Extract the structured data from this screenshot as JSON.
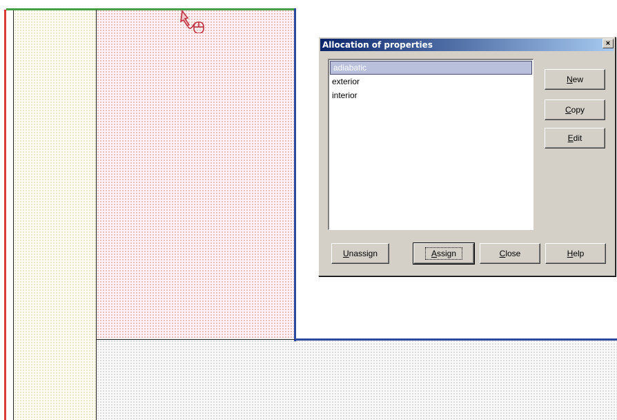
{
  "dialog": {
    "title": "Allocation of properties",
    "close_glyph": "×",
    "list_items": [
      {
        "label": "adiabatic",
        "selected": true
      },
      {
        "label": "exterior",
        "selected": false
      },
      {
        "label": "interior",
        "selected": false
      }
    ],
    "buttons": {
      "new": {
        "pre": "",
        "mn": "N",
        "post": "ew"
      },
      "copy": {
        "pre": "",
        "mn": "C",
        "post": "opy"
      },
      "edit": {
        "pre": "",
        "mn": "E",
        "post": "dit"
      },
      "unassign": {
        "pre": "",
        "mn": "U",
        "post": "nassign"
      },
      "assign": {
        "pre": "",
        "mn": "A",
        "post": "ssign"
      },
      "close": {
        "pre": "",
        "mn": "C",
        "post": "lose"
      },
      "help": {
        "pre": "",
        "mn": "H",
        "post": "elp"
      }
    }
  },
  "colors": {
    "red_boundary": "#d83a3a",
    "green_boundary": "#44a046",
    "blue_boundary": "#2a4aa0",
    "mouse_icon": "#c03040"
  },
  "icons": {
    "cursor": "mouse-pointer-icon"
  }
}
